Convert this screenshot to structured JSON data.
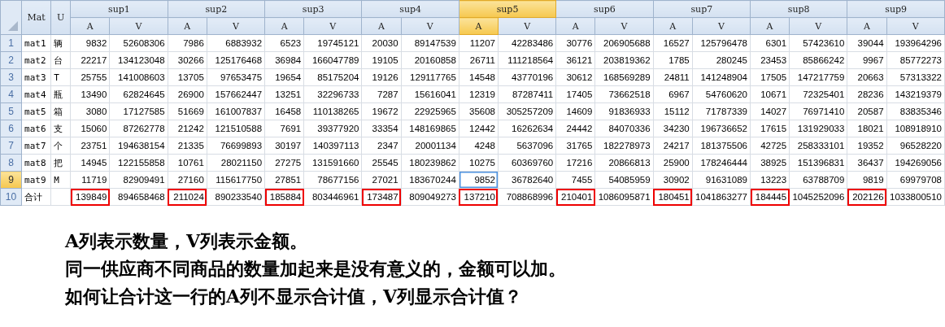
{
  "headers": {
    "mat": "Mat",
    "unit": "U"
  },
  "suppliers": [
    {
      "name": "sup1",
      "selected": false,
      "subcolumns": [
        {
          "label": "A",
          "selected": false
        },
        {
          "label": "V",
          "selected": false
        }
      ]
    },
    {
      "name": "sup2",
      "selected": false,
      "subcolumns": [
        {
          "label": "A",
          "selected": false
        },
        {
          "label": "V",
          "selected": false
        }
      ]
    },
    {
      "name": "sup3",
      "selected": false,
      "subcolumns": [
        {
          "label": "A",
          "selected": false
        },
        {
          "label": "V",
          "selected": false
        }
      ]
    },
    {
      "name": "sup4",
      "selected": false,
      "subcolumns": [
        {
          "label": "A",
          "selected": false
        },
        {
          "label": "V",
          "selected": false
        }
      ]
    },
    {
      "name": "sup5",
      "selected": true,
      "subcolumns": [
        {
          "label": "A",
          "selected": true
        },
        {
          "label": "V",
          "selected": false
        }
      ]
    },
    {
      "name": "sup6",
      "selected": false,
      "subcolumns": [
        {
          "label": "A",
          "selected": false
        },
        {
          "label": "V",
          "selected": false
        }
      ]
    },
    {
      "name": "sup7",
      "selected": false,
      "subcolumns": [
        {
          "label": "A",
          "selected": false
        },
        {
          "label": "V",
          "selected": false
        }
      ]
    },
    {
      "name": "sup8",
      "selected": false,
      "subcolumns": [
        {
          "label": "A",
          "selected": false
        },
        {
          "label": "V",
          "selected": false
        }
      ]
    },
    {
      "name": "sup9",
      "selected": false,
      "subcolumns": [
        {
          "label": "A",
          "selected": false
        },
        {
          "label": "V",
          "selected": false
        }
      ]
    }
  ],
  "rows": [
    {
      "number": "1",
      "selected": false,
      "mat": "mat1",
      "unit": "辆",
      "cells": [
        {
          "value": "9832",
          "selected": false,
          "outlined": false
        },
        {
          "value": "52608306",
          "selected": false,
          "outlined": false
        },
        {
          "value": "7986",
          "selected": false,
          "outlined": false
        },
        {
          "value": "6883932",
          "selected": false,
          "outlined": false
        },
        {
          "value": "6523",
          "selected": false,
          "outlined": false
        },
        {
          "value": "19745121",
          "selected": false,
          "outlined": false
        },
        {
          "value": "20030",
          "selected": false,
          "outlined": false
        },
        {
          "value": "89147539",
          "selected": false,
          "outlined": false
        },
        {
          "value": "11207",
          "selected": false,
          "outlined": false
        },
        {
          "value": "42283486",
          "selected": false,
          "outlined": false
        },
        {
          "value": "30776",
          "selected": false,
          "outlined": false
        },
        {
          "value": "206905688",
          "selected": false,
          "outlined": false
        },
        {
          "value": "16527",
          "selected": false,
          "outlined": false
        },
        {
          "value": "125796478",
          "selected": false,
          "outlined": false
        },
        {
          "value": "6301",
          "selected": false,
          "outlined": false
        },
        {
          "value": "57423610",
          "selected": false,
          "outlined": false
        },
        {
          "value": "39044",
          "selected": false,
          "outlined": false
        },
        {
          "value": "193964296",
          "selected": false,
          "outlined": false
        }
      ]
    },
    {
      "number": "2",
      "selected": false,
      "mat": "mat2",
      "unit": "台",
      "cells": [
        {
          "value": "22217",
          "selected": false,
          "outlined": false
        },
        {
          "value": "134123048",
          "selected": false,
          "outlined": false
        },
        {
          "value": "30266",
          "selected": false,
          "outlined": false
        },
        {
          "value": "125176468",
          "selected": false,
          "outlined": false
        },
        {
          "value": "36984",
          "selected": false,
          "outlined": false
        },
        {
          "value": "166047789",
          "selected": false,
          "outlined": false
        },
        {
          "value": "19105",
          "selected": false,
          "outlined": false
        },
        {
          "value": "20160858",
          "selected": false,
          "outlined": false
        },
        {
          "value": "26711",
          "selected": false,
          "outlined": false
        },
        {
          "value": "111218564",
          "selected": false,
          "outlined": false
        },
        {
          "value": "36121",
          "selected": false,
          "outlined": false
        },
        {
          "value": "203819362",
          "selected": false,
          "outlined": false
        },
        {
          "value": "1785",
          "selected": false,
          "outlined": false
        },
        {
          "value": "280245",
          "selected": false,
          "outlined": false
        },
        {
          "value": "23453",
          "selected": false,
          "outlined": false
        },
        {
          "value": "85866242",
          "selected": false,
          "outlined": false
        },
        {
          "value": "9967",
          "selected": false,
          "outlined": false
        },
        {
          "value": "85772273",
          "selected": false,
          "outlined": false
        }
      ]
    },
    {
      "number": "3",
      "selected": false,
      "mat": "mat3",
      "unit": "T",
      "cells": [
        {
          "value": "25755",
          "selected": false,
          "outlined": false
        },
        {
          "value": "141008603",
          "selected": false,
          "outlined": false
        },
        {
          "value": "13705",
          "selected": false,
          "outlined": false
        },
        {
          "value": "97653475",
          "selected": false,
          "outlined": false
        },
        {
          "value": "19654",
          "selected": false,
          "outlined": false
        },
        {
          "value": "85175204",
          "selected": false,
          "outlined": false
        },
        {
          "value": "19126",
          "selected": false,
          "outlined": false
        },
        {
          "value": "129117765",
          "selected": false,
          "outlined": false
        },
        {
          "value": "14548",
          "selected": false,
          "outlined": false
        },
        {
          "value": "43770196",
          "selected": false,
          "outlined": false
        },
        {
          "value": "30612",
          "selected": false,
          "outlined": false
        },
        {
          "value": "168569289",
          "selected": false,
          "outlined": false
        },
        {
          "value": "24811",
          "selected": false,
          "outlined": false
        },
        {
          "value": "141248904",
          "selected": false,
          "outlined": false
        },
        {
          "value": "17505",
          "selected": false,
          "outlined": false
        },
        {
          "value": "147217759",
          "selected": false,
          "outlined": false
        },
        {
          "value": "20663",
          "selected": false,
          "outlined": false
        },
        {
          "value": "57313322",
          "selected": false,
          "outlined": false
        }
      ]
    },
    {
      "number": "4",
      "selected": false,
      "mat": "mat4",
      "unit": "瓶",
      "cells": [
        {
          "value": "13490",
          "selected": false,
          "outlined": false
        },
        {
          "value": "62824645",
          "selected": false,
          "outlined": false
        },
        {
          "value": "26900",
          "selected": false,
          "outlined": false
        },
        {
          "value": "157662447",
          "selected": false,
          "outlined": false
        },
        {
          "value": "13251",
          "selected": false,
          "outlined": false
        },
        {
          "value": "32296733",
          "selected": false,
          "outlined": false
        },
        {
          "value": "7287",
          "selected": false,
          "outlined": false
        },
        {
          "value": "15616041",
          "selected": false,
          "outlined": false
        },
        {
          "value": "12319",
          "selected": false,
          "outlined": false
        },
        {
          "value": "87287411",
          "selected": false,
          "outlined": false
        },
        {
          "value": "17405",
          "selected": false,
          "outlined": false
        },
        {
          "value": "73662518",
          "selected": false,
          "outlined": false
        },
        {
          "value": "6967",
          "selected": false,
          "outlined": false
        },
        {
          "value": "54760620",
          "selected": false,
          "outlined": false
        },
        {
          "value": "10671",
          "selected": false,
          "outlined": false
        },
        {
          "value": "72325401",
          "selected": false,
          "outlined": false
        },
        {
          "value": "28236",
          "selected": false,
          "outlined": false
        },
        {
          "value": "143219379",
          "selected": false,
          "outlined": false
        }
      ]
    },
    {
      "number": "5",
      "selected": false,
      "mat": "mat5",
      "unit": "箱",
      "cells": [
        {
          "value": "3080",
          "selected": false,
          "outlined": false
        },
        {
          "value": "17127585",
          "selected": false,
          "outlined": false
        },
        {
          "value": "51669",
          "selected": false,
          "outlined": false
        },
        {
          "value": "161007837",
          "selected": false,
          "outlined": false
        },
        {
          "value": "16458",
          "selected": false,
          "outlined": false
        },
        {
          "value": "110138265",
          "selected": false,
          "outlined": false
        },
        {
          "value": "19672",
          "selected": false,
          "outlined": false
        },
        {
          "value": "22925965",
          "selected": false,
          "outlined": false
        },
        {
          "value": "35608",
          "selected": false,
          "outlined": false
        },
        {
          "value": "305257209",
          "selected": false,
          "outlined": false
        },
        {
          "value": "14609",
          "selected": false,
          "outlined": false
        },
        {
          "value": "91836933",
          "selected": false,
          "outlined": false
        },
        {
          "value": "15112",
          "selected": false,
          "outlined": false
        },
        {
          "value": "71787339",
          "selected": false,
          "outlined": false
        },
        {
          "value": "14027",
          "selected": false,
          "outlined": false
        },
        {
          "value": "76971410",
          "selected": false,
          "outlined": false
        },
        {
          "value": "20587",
          "selected": false,
          "outlined": false
        },
        {
          "value": "83835346",
          "selected": false,
          "outlined": false
        }
      ]
    },
    {
      "number": "6",
      "selected": false,
      "mat": "mat6",
      "unit": "支",
      "cells": [
        {
          "value": "15060",
          "selected": false,
          "outlined": false
        },
        {
          "value": "87262778",
          "selected": false,
          "outlined": false
        },
        {
          "value": "21242",
          "selected": false,
          "outlined": false
        },
        {
          "value": "121510588",
          "selected": false,
          "outlined": false
        },
        {
          "value": "7691",
          "selected": false,
          "outlined": false
        },
        {
          "value": "39377920",
          "selected": false,
          "outlined": false
        },
        {
          "value": "33354",
          "selected": false,
          "outlined": false
        },
        {
          "value": "148169865",
          "selected": false,
          "outlined": false
        },
        {
          "value": "12442",
          "selected": false,
          "outlined": false
        },
        {
          "value": "16262634",
          "selected": false,
          "outlined": false
        },
        {
          "value": "24442",
          "selected": false,
          "outlined": false
        },
        {
          "value": "84070336",
          "selected": false,
          "outlined": false
        },
        {
          "value": "34230",
          "selected": false,
          "outlined": false
        },
        {
          "value": "196736652",
          "selected": false,
          "outlined": false
        },
        {
          "value": "17615",
          "selected": false,
          "outlined": false
        },
        {
          "value": "131929033",
          "selected": false,
          "outlined": false
        },
        {
          "value": "18021",
          "selected": false,
          "outlined": false
        },
        {
          "value": "108918910",
          "selected": false,
          "outlined": false
        }
      ]
    },
    {
      "number": "7",
      "selected": false,
      "mat": "mat7",
      "unit": "个",
      "cells": [
        {
          "value": "23751",
          "selected": false,
          "outlined": false
        },
        {
          "value": "194638154",
          "selected": false,
          "outlined": false
        },
        {
          "value": "21335",
          "selected": false,
          "outlined": false
        },
        {
          "value": "76699893",
          "selected": false,
          "outlined": false
        },
        {
          "value": "30197",
          "selected": false,
          "outlined": false
        },
        {
          "value": "140397113",
          "selected": false,
          "outlined": false
        },
        {
          "value": "2347",
          "selected": false,
          "outlined": false
        },
        {
          "value": "20001134",
          "selected": false,
          "outlined": false
        },
        {
          "value": "4248",
          "selected": false,
          "outlined": false
        },
        {
          "value": "5637096",
          "selected": false,
          "outlined": false
        },
        {
          "value": "31765",
          "selected": false,
          "outlined": false
        },
        {
          "value": "182278973",
          "selected": false,
          "outlined": false
        },
        {
          "value": "24217",
          "selected": false,
          "outlined": false
        },
        {
          "value": "181375506",
          "selected": false,
          "outlined": false
        },
        {
          "value": "42725",
          "selected": false,
          "outlined": false
        },
        {
          "value": "258333101",
          "selected": false,
          "outlined": false
        },
        {
          "value": "19352",
          "selected": false,
          "outlined": false
        },
        {
          "value": "96528220",
          "selected": false,
          "outlined": false
        }
      ]
    },
    {
      "number": "8",
      "selected": false,
      "mat": "mat8",
      "unit": "把",
      "cells": [
        {
          "value": "14945",
          "selected": false,
          "outlined": false
        },
        {
          "value": "122155858",
          "selected": false,
          "outlined": false
        },
        {
          "value": "10761",
          "selected": false,
          "outlined": false
        },
        {
          "value": "28021150",
          "selected": false,
          "outlined": false
        },
        {
          "value": "27275",
          "selected": false,
          "outlined": false
        },
        {
          "value": "131591660",
          "selected": false,
          "outlined": false
        },
        {
          "value": "25545",
          "selected": false,
          "outlined": false
        },
        {
          "value": "180239862",
          "selected": false,
          "outlined": false
        },
        {
          "value": "10275",
          "selected": false,
          "outlined": false
        },
        {
          "value": "60369760",
          "selected": false,
          "outlined": false
        },
        {
          "value": "17216",
          "selected": false,
          "outlined": false
        },
        {
          "value": "20866813",
          "selected": false,
          "outlined": false
        },
        {
          "value": "25900",
          "selected": false,
          "outlined": false
        },
        {
          "value": "178246444",
          "selected": false,
          "outlined": false
        },
        {
          "value": "38925",
          "selected": false,
          "outlined": false
        },
        {
          "value": "151396831",
          "selected": false,
          "outlined": false
        },
        {
          "value": "36437",
          "selected": false,
          "outlined": false
        },
        {
          "value": "194269056",
          "selected": false,
          "outlined": false
        }
      ]
    },
    {
      "number": "9",
      "selected": true,
      "mat": "mat9",
      "unit": "M",
      "cells": [
        {
          "value": "11719",
          "selected": false,
          "outlined": false
        },
        {
          "value": "82909491",
          "selected": false,
          "outlined": false
        },
        {
          "value": "27160",
          "selected": false,
          "outlined": false
        },
        {
          "value": "115617750",
          "selected": false,
          "outlined": false
        },
        {
          "value": "27851",
          "selected": false,
          "outlined": false
        },
        {
          "value": "78677156",
          "selected": false,
          "outlined": false
        },
        {
          "value": "27021",
          "selected": false,
          "outlined": false
        },
        {
          "value": "183670244",
          "selected": false,
          "outlined": false
        },
        {
          "value": "9852",
          "selected": true,
          "outlined": false
        },
        {
          "value": "36782640",
          "selected": false,
          "outlined": false
        },
        {
          "value": "7455",
          "selected": false,
          "outlined": false
        },
        {
          "value": "54085959",
          "selected": false,
          "outlined": false
        },
        {
          "value": "30902",
          "selected": false,
          "outlined": false
        },
        {
          "value": "91631089",
          "selected": false,
          "outlined": false
        },
        {
          "value": "13223",
          "selected": false,
          "outlined": false
        },
        {
          "value": "63788709",
          "selected": false,
          "outlined": false
        },
        {
          "value": "9819",
          "selected": false,
          "outlined": false
        },
        {
          "value": "69979708",
          "selected": false,
          "outlined": false
        }
      ]
    },
    {
      "number": "10",
      "selected": false,
      "mat": "合计",
      "unit": "",
      "cells": [
        {
          "value": "139849",
          "selected": false,
          "outlined": true
        },
        {
          "value": "894658468",
          "selected": false,
          "outlined": false
        },
        {
          "value": "211024",
          "selected": false,
          "outlined": true
        },
        {
          "value": "890233540",
          "selected": false,
          "outlined": false
        },
        {
          "value": "185884",
          "selected": false,
          "outlined": true
        },
        {
          "value": "803446961",
          "selected": false,
          "outlined": false
        },
        {
          "value": "173487",
          "selected": false,
          "outlined": true
        },
        {
          "value": "809049273",
          "selected": false,
          "outlined": false
        },
        {
          "value": "137210",
          "selected": false,
          "outlined": true
        },
        {
          "value": "708868996",
          "selected": false,
          "outlined": false
        },
        {
          "value": "210401",
          "selected": false,
          "outlined": true
        },
        {
          "value": "1086095871",
          "selected": false,
          "outlined": false
        },
        {
          "value": "180451",
          "selected": false,
          "outlined": true
        },
        {
          "value": "1041863277",
          "selected": false,
          "outlined": false
        },
        {
          "value": "184445",
          "selected": false,
          "outlined": true
        },
        {
          "value": "1045252096",
          "selected": false,
          "outlined": false
        },
        {
          "value": "202126",
          "selected": false,
          "outlined": true
        },
        {
          "value": "1033800510",
          "selected": false,
          "outlined": false
        }
      ]
    }
  ],
  "notes": [
    "A列表示数量，V列表示金额。",
    "同一供应商不同商品的数量加起来是没有意义的，金额可以加。",
    "如何让合计这一行的A列不显示合计值，V列显示合计值？"
  ]
}
